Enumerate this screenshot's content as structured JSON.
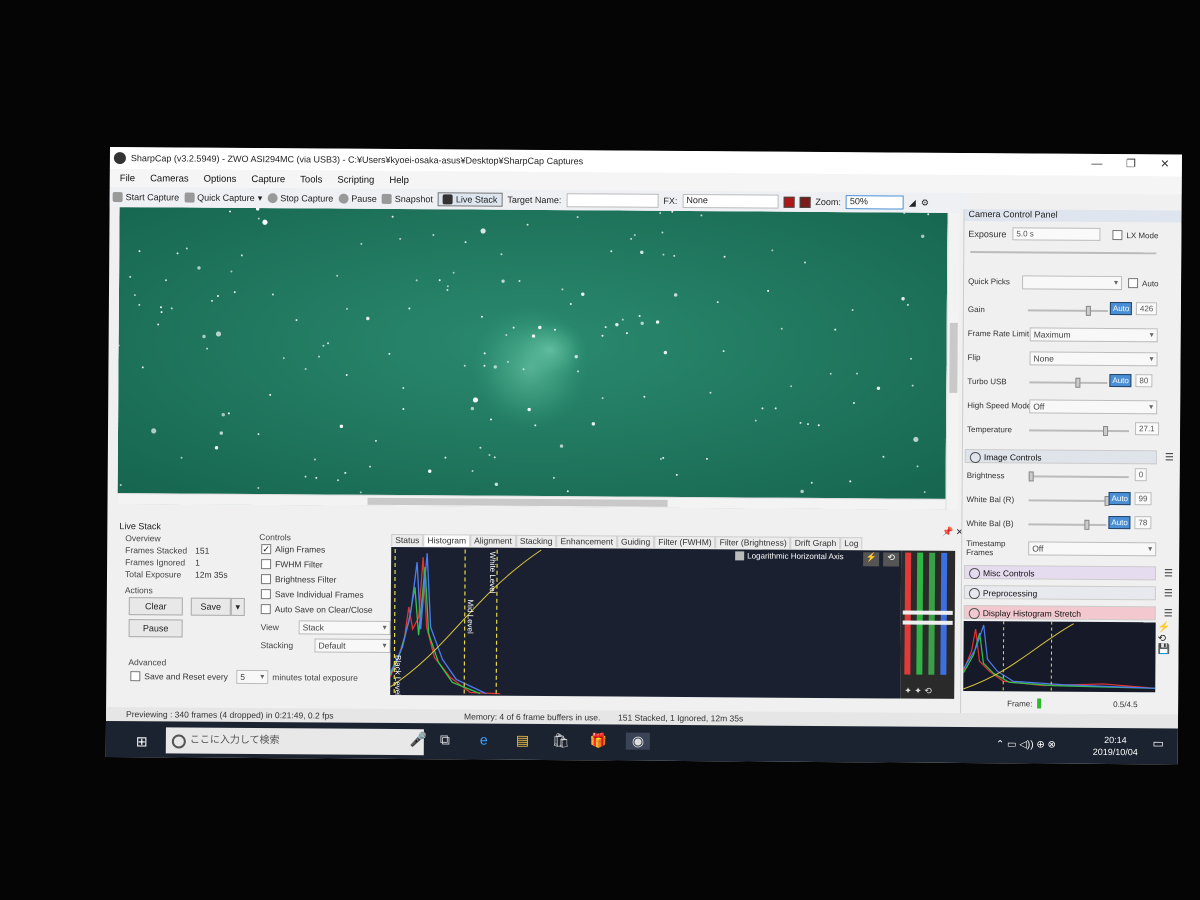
{
  "window": {
    "title": "SharpCap (v3.2.5949) - ZWO ASI294MC (via USB3) - C:¥Users¥kyoei-osaka-asus¥Desktop¥SharpCap Captures",
    "minimize": "—",
    "maximize": "❐",
    "close": "✕"
  },
  "menu": [
    "File",
    "Cameras",
    "Options",
    "Capture",
    "Tools",
    "Scripting",
    "Help"
  ],
  "toolbar": {
    "start_capture": "Start Capture",
    "quick_capture": "Quick Capture",
    "stop_capture": "Stop Capture",
    "pause": "Pause",
    "snapshot": "Snapshot",
    "live_stack": "Live Stack",
    "target_name_label": "Target Name:",
    "fx_label": "FX:",
    "fx_value": "None",
    "zoom_label": "Zoom:",
    "zoom_value": "50%"
  },
  "live_stack": {
    "title": "Live Stack",
    "overview_label": "Overview",
    "frames_stacked_label": "Frames Stacked",
    "frames_stacked": "151",
    "frames_ignored_label": "Frames Ignored",
    "frames_ignored": "1",
    "total_exposure_label": "Total Exposure",
    "total_exposure": "12m 35s",
    "actions_label": "Actions",
    "clear": "Clear",
    "save": "Save",
    "pause": "Pause",
    "advanced_label": "Advanced",
    "save_reset_label": "Save and Reset every",
    "save_reset_value": "5",
    "minutes_label": "minutes total exposure",
    "controls_label": "Controls",
    "align_frames": "Align Frames",
    "fwhm_filter": "FWHM Filter",
    "brightness_filter": "Brightness Filter",
    "save_individual": "Save Individual Frames",
    "auto_save": "Auto Save on Clear/Close",
    "view_label": "View",
    "view_value": "Stack",
    "stacking_label": "Stacking",
    "stacking_value": "Default"
  },
  "tabs": [
    "Status",
    "Histogram",
    "Alignment",
    "Stacking",
    "Enhancement",
    "Guiding",
    "Filter (FWHM)",
    "Filter (Brightness)",
    "Drift Graph",
    "Log"
  ],
  "histogram": {
    "log_axis_label": "Logarithmic Horizontal Axis",
    "black_level": "Black Level",
    "mid_level": "Mid Level",
    "white_level": "White Level"
  },
  "status": {
    "previewing": "Previewing : 340 frames (4 dropped) in 0:21:49, 0.2 fps",
    "memory": "Memory: 4 of 6 frame buffers in use.",
    "stacked": "151 Stacked, 1 Ignored, 12m 35s"
  },
  "camera_panel": {
    "title": "Camera Control Panel",
    "exposure_label": "Exposure",
    "exposure_value": "5.0 s",
    "lx_mode": "LX Mode",
    "quick_picks_label": "Quick Picks",
    "auto": "Auto",
    "gain_label": "Gain",
    "gain_value": "426",
    "frame_rate_label": "Frame Rate Limit",
    "frame_rate_value": "Maximum",
    "flip_label": "Flip",
    "flip_value": "None",
    "turbo_usb_label": "Turbo USB",
    "turbo_usb_value": "80",
    "high_speed_label": "High Speed Mode",
    "high_speed_value": "Off",
    "temperature_label": "Temperature",
    "temperature_value": "27.1",
    "image_controls": "Image Controls",
    "brightness_label": "Brightness",
    "brightness_value": "0",
    "wb_r_label": "White Bal (R)",
    "wb_r_value": "99",
    "wb_b_label": "White Bal (B)",
    "wb_b_value": "78",
    "timestamp_label": "Timestamp Frames",
    "timestamp_value": "Off",
    "misc_controls": "Misc Controls",
    "preprocessing": "Preprocessing",
    "display_histogram": "Display Histogram Stretch",
    "frame_label": "Frame:",
    "frame_value": "0.5/4.5"
  },
  "taskbar": {
    "search_placeholder": "ここに入力して検索",
    "time": "20:14",
    "date": "2019/10/04"
  },
  "colors": {
    "sky": "#1f7a62",
    "histogram_bg": "#1b2030",
    "accent": "#4a8fd6",
    "display_hist_header": "#f3c9cf"
  }
}
